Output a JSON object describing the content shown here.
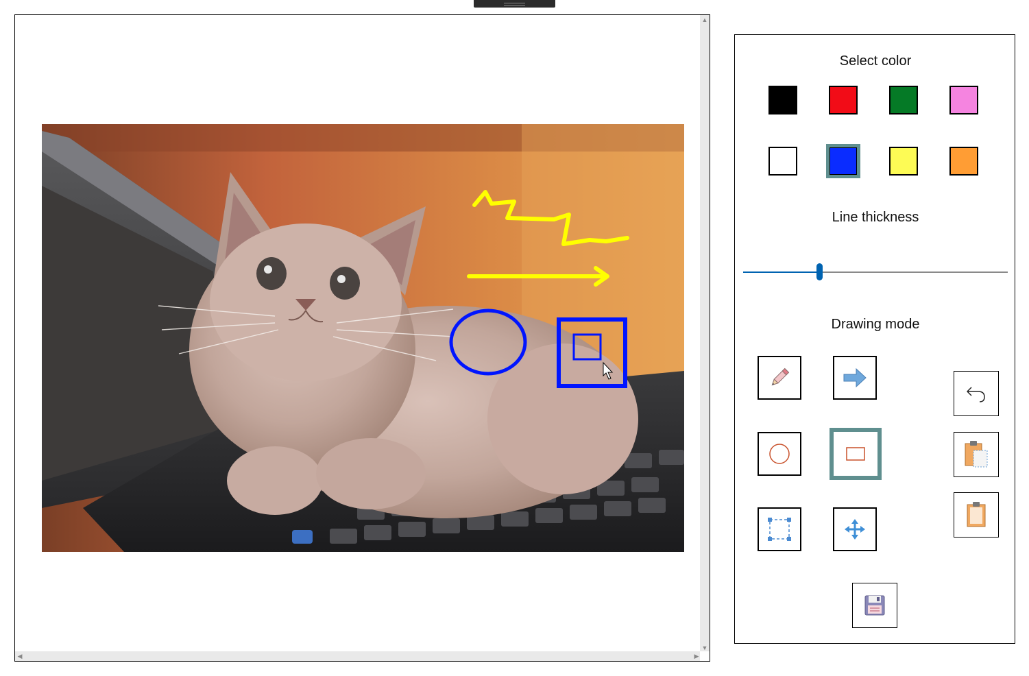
{
  "panel": {
    "select_color_title": "Select color",
    "line_thickness_title": "Line thickness",
    "drawing_mode_title": "Drawing mode"
  },
  "colors": [
    {
      "name": "black",
      "hex": "#000000"
    },
    {
      "name": "red",
      "hex": "#f20c17"
    },
    {
      "name": "green",
      "hex": "#057a26"
    },
    {
      "name": "pink",
      "hex": "#f584e0"
    },
    {
      "name": "white",
      "hex": "#ffffff"
    },
    {
      "name": "blue",
      "hex": "#0a2cff",
      "selected": true
    },
    {
      "name": "yellow",
      "hex": "#fdfb55"
    },
    {
      "name": "orange",
      "hex": "#ff9d34"
    }
  ],
  "line_thickness": {
    "value_fraction": 0.29
  },
  "drawing_modes": [
    {
      "name": "pencil-icon",
      "selected": false
    },
    {
      "name": "arrow-icon",
      "selected": false
    },
    {
      "name": "ellipse-icon",
      "selected": false
    },
    {
      "name": "rectangle-icon",
      "selected": true
    },
    {
      "name": "selection-icon",
      "selected": false
    },
    {
      "name": "move-icon",
      "selected": false
    }
  ],
  "actions": [
    {
      "name": "undo-icon"
    },
    {
      "name": "paste-icon"
    },
    {
      "name": "clipboard-icon"
    },
    {
      "name": "save-icon"
    }
  ],
  "drawing": {
    "stroke_colors": {
      "yellow": "#ffff00",
      "blue": "#0015ff"
    },
    "image_subject": "kitten-on-laptop"
  }
}
